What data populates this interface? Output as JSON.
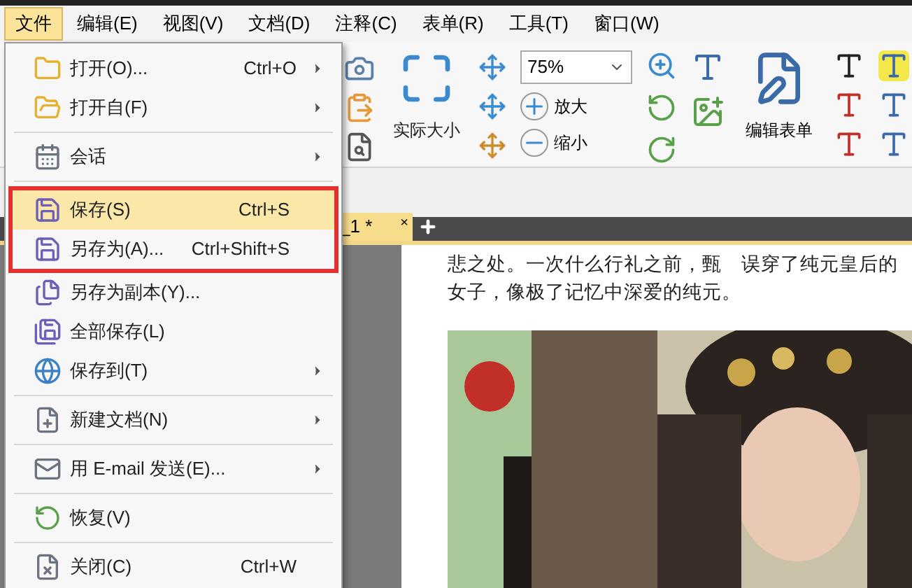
{
  "menubar": [
    {
      "label": "文件",
      "selected": true
    },
    {
      "label": "编辑(E)",
      "selected": false
    },
    {
      "label": "视图(V)",
      "selected": false
    },
    {
      "label": "文档(D)",
      "selected": false
    },
    {
      "label": "注释(C)",
      "selected": false
    },
    {
      "label": "表单(R)",
      "selected": false
    },
    {
      "label": "工具(T)",
      "selected": false
    },
    {
      "label": "窗口(W)",
      "selected": false
    }
  ],
  "file_menu": {
    "sections": [
      [
        {
          "label": "打开(O)...",
          "shortcut": "Ctrl+O",
          "submenu": true,
          "selected": false,
          "outlined": false
        },
        {
          "label": "打开自(F)",
          "submenu": true,
          "selected": false,
          "outlined": false
        }
      ],
      [
        {
          "label": "会话",
          "submenu": true,
          "selected": false,
          "outlined": false
        }
      ],
      [
        {
          "label": "保存(S)",
          "shortcut": "Ctrl+S",
          "submenu": false,
          "selected": true,
          "outlined": true
        },
        {
          "label": "另存为(A)...",
          "shortcut": "Ctrl+Shift+S",
          "submenu": false,
          "selected": false,
          "outlined": true
        },
        {
          "label": "另存为副本(Y)...",
          "submenu": false,
          "selected": false,
          "outlined": false
        },
        {
          "label": "全部保存(L)",
          "submenu": false,
          "selected": false,
          "outlined": false
        },
        {
          "label": "保存到(T)",
          "submenu": true,
          "selected": false,
          "outlined": false
        }
      ],
      [
        {
          "label": "新建文档(N)",
          "submenu": true,
          "selected": false,
          "outlined": false
        }
      ],
      [
        {
          "label": "用 E-mail 发送(E)...",
          "submenu": true,
          "selected": false,
          "outlined": false
        }
      ],
      [
        {
          "label": "恢复(V)",
          "submenu": false,
          "selected": false,
          "outlined": false
        }
      ],
      [
        {
          "label": "关闭(C)",
          "shortcut": "Ctrl+W",
          "submenu": false,
          "selected": false,
          "outlined": false
        }
      ]
    ]
  },
  "toolbar": {
    "actual_size": "实际大小",
    "zoom_value": "75%",
    "zoom_in": "放大",
    "zoom_out": "缩小",
    "edit_form": "编辑表单"
  },
  "document_tab": {
    "label": "_1 *",
    "close": "×",
    "selected": true
  },
  "page": {
    "lines": [
      "悲之处。一次什么行礼之前，甄　误穿了纯元皇后的",
      "女子，像极了记忆中深爱的纯元。"
    ]
  }
}
